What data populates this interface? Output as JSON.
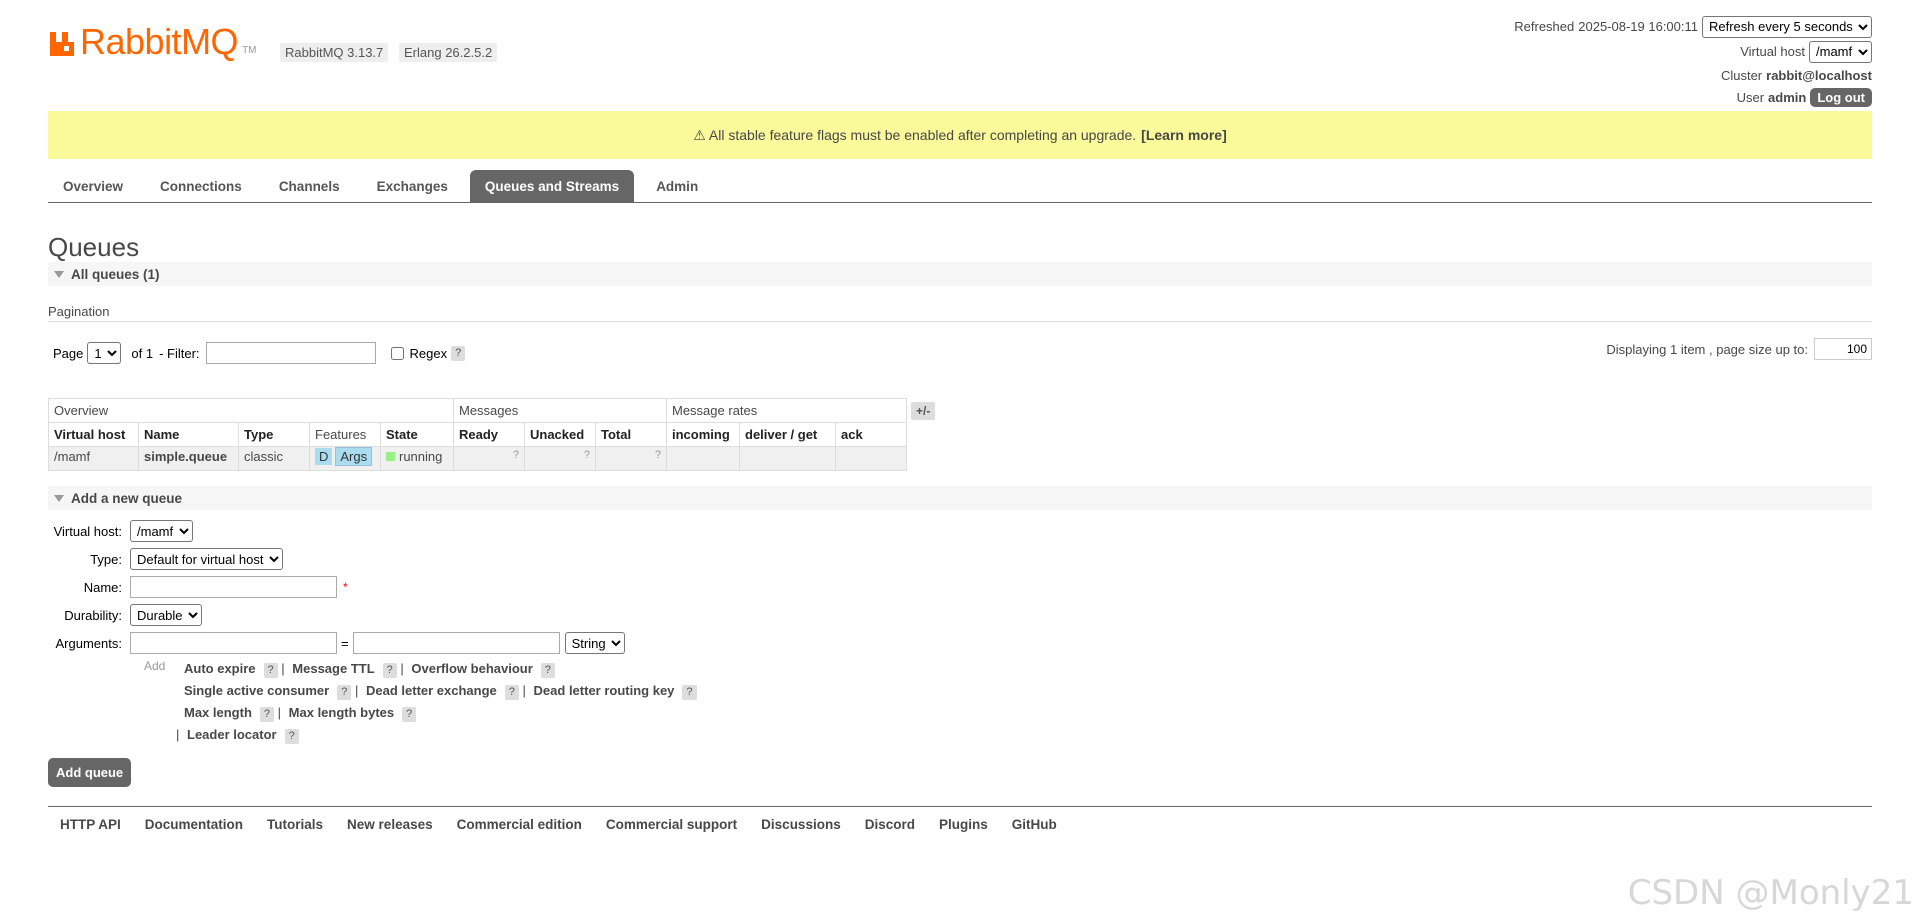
{
  "header": {
    "logo_text": "RabbitMQ",
    "logo_tm": "TM",
    "version": "RabbitMQ 3.13.7",
    "erlang": "Erlang 26.2.5.2",
    "refreshed_label": "Refreshed",
    "refreshed_time": "2025-08-19 16:00:11",
    "refresh_option": "Refresh every 5 seconds",
    "vhost_label": "Virtual host",
    "vhost_value": "/mamf",
    "cluster_label": "Cluster",
    "cluster_value": "rabbit@localhost",
    "user_label": "User",
    "user_value": "admin",
    "logout_label": "Log out"
  },
  "banner": {
    "text": "⚠ All stable feature flags must be enabled after completing an upgrade.",
    "link": "[Learn more]"
  },
  "tabs": [
    {
      "label": "Overview",
      "active": false
    },
    {
      "label": "Connections",
      "active": false
    },
    {
      "label": "Channels",
      "active": false
    },
    {
      "label": "Exchanges",
      "active": false
    },
    {
      "label": "Queues and Streams",
      "active": true
    },
    {
      "label": "Admin",
      "active": false
    }
  ],
  "page": {
    "title": "Queues",
    "all_queues": "All queues (1)",
    "pagination_title": "Pagination",
    "page_label": "Page",
    "page_value": "1",
    "of_label": "of 1",
    "filter_label": "- Filter:",
    "regex_label": "Regex",
    "help": "?",
    "displaying": "Displaying 1 item , page size up to:",
    "page_size": "100"
  },
  "table": {
    "groups": {
      "overview": "Overview",
      "messages": "Messages",
      "rates": "Message rates",
      "toggle": "+/-"
    },
    "columns": [
      "Virtual host",
      "Name",
      "Type",
      "Features",
      "State",
      "Ready",
      "Unacked",
      "Total",
      "incoming",
      "deliver / get",
      "ack"
    ],
    "row": {
      "vhost": "/mamf",
      "name": "simple.queue",
      "type": "classic",
      "feature_d": "D",
      "feature_args": "Args",
      "state": "running",
      "q": "?"
    },
    "colors": {
      "running": "#98f086",
      "feature": "#aadcf0"
    }
  },
  "add_queue": {
    "title": "Add a new queue",
    "vhost_label": "Virtual host:",
    "vhost_value": "/mamf",
    "type_label": "Type:",
    "type_value": "Default for virtual host",
    "name_label": "Name:",
    "required": "*",
    "durability_label": "Durability:",
    "durability_value": "Durable",
    "arguments_label": "Arguments:",
    "equals": "=",
    "arg_type": "String",
    "add_label": "Add",
    "args": {
      "auto_expire": "Auto expire",
      "message_ttl": "Message TTL",
      "overflow": "Overflow behaviour",
      "single_active": "Single active consumer",
      "dlx": "Dead letter exchange",
      "dlrk": "Dead letter routing key",
      "max_length": "Max length",
      "max_length_bytes": "Max length bytes",
      "leader_locator": "Leader locator",
      "sep": "|"
    },
    "submit": "Add queue"
  },
  "footer": [
    "HTTP API",
    "Documentation",
    "Tutorials",
    "New releases",
    "Commercial edition",
    "Commercial support",
    "Discussions",
    "Discord",
    "Plugins",
    "GitHub"
  ],
  "watermark": "CSDN @Monly21",
  "colors": {
    "brand": "#ff6600",
    "banner": "#fbfa9b",
    "tab_active": "#666666"
  }
}
